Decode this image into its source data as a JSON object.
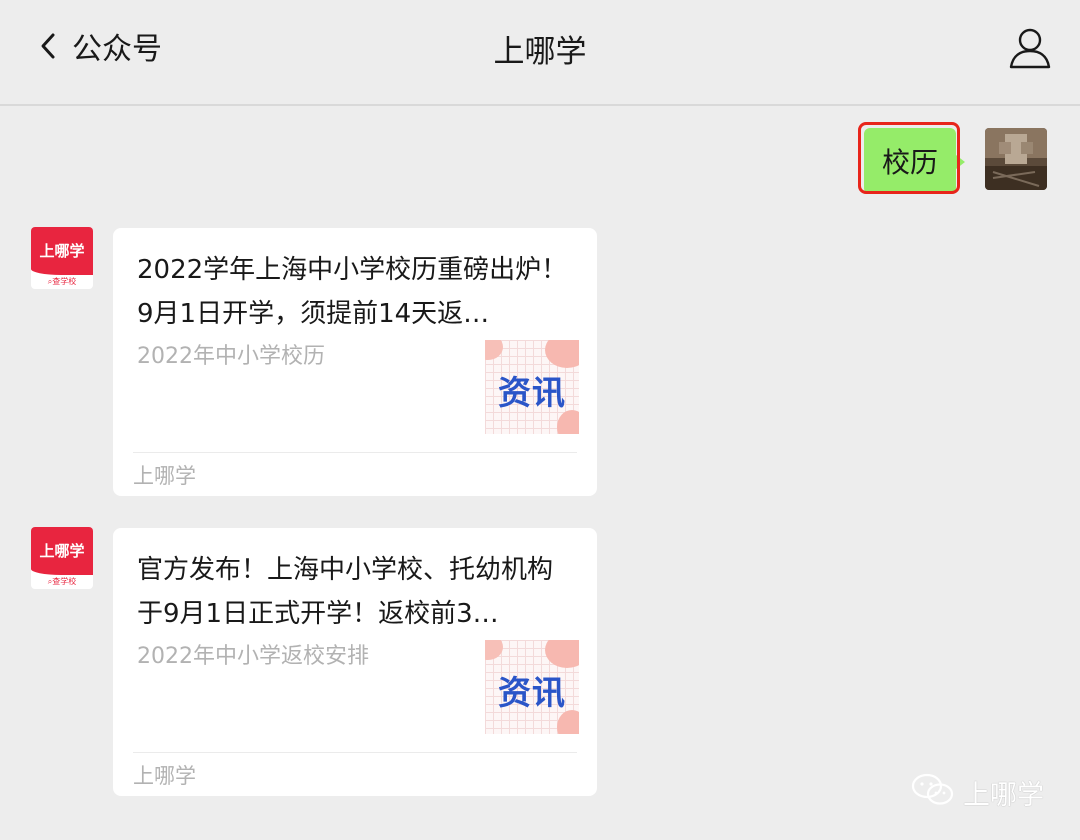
{
  "header": {
    "back_label": "公众号",
    "title": "上哪学"
  },
  "chat": {
    "user_message": "校历",
    "brand_avatar": {
      "text": "上哪学",
      "subtext": "查学校"
    },
    "articles": [
      {
        "title": "2022学年上海中小学校历重磅出炉！9月1日开学，须提前14天返…",
        "description": "2022年中小学校历",
        "thumb_label": "资讯",
        "source": "上哪学"
      },
      {
        "title": "官方发布！上海中小学校、托幼机构于9月1日正式开学！返校前3…",
        "description": "2022年中小学返校安排",
        "thumb_label": "资讯",
        "source": "上哪学"
      }
    ]
  },
  "watermark": {
    "text": "上哪学"
  },
  "colors": {
    "background": "#ededed",
    "bubble": "#95ec69",
    "highlight": "#e8251b",
    "brand": "#e8253f",
    "thumb_text": "#2a55c8"
  },
  "icons": [
    "chevron-left-icon",
    "user-icon",
    "search-icon",
    "wechat-icon"
  ]
}
